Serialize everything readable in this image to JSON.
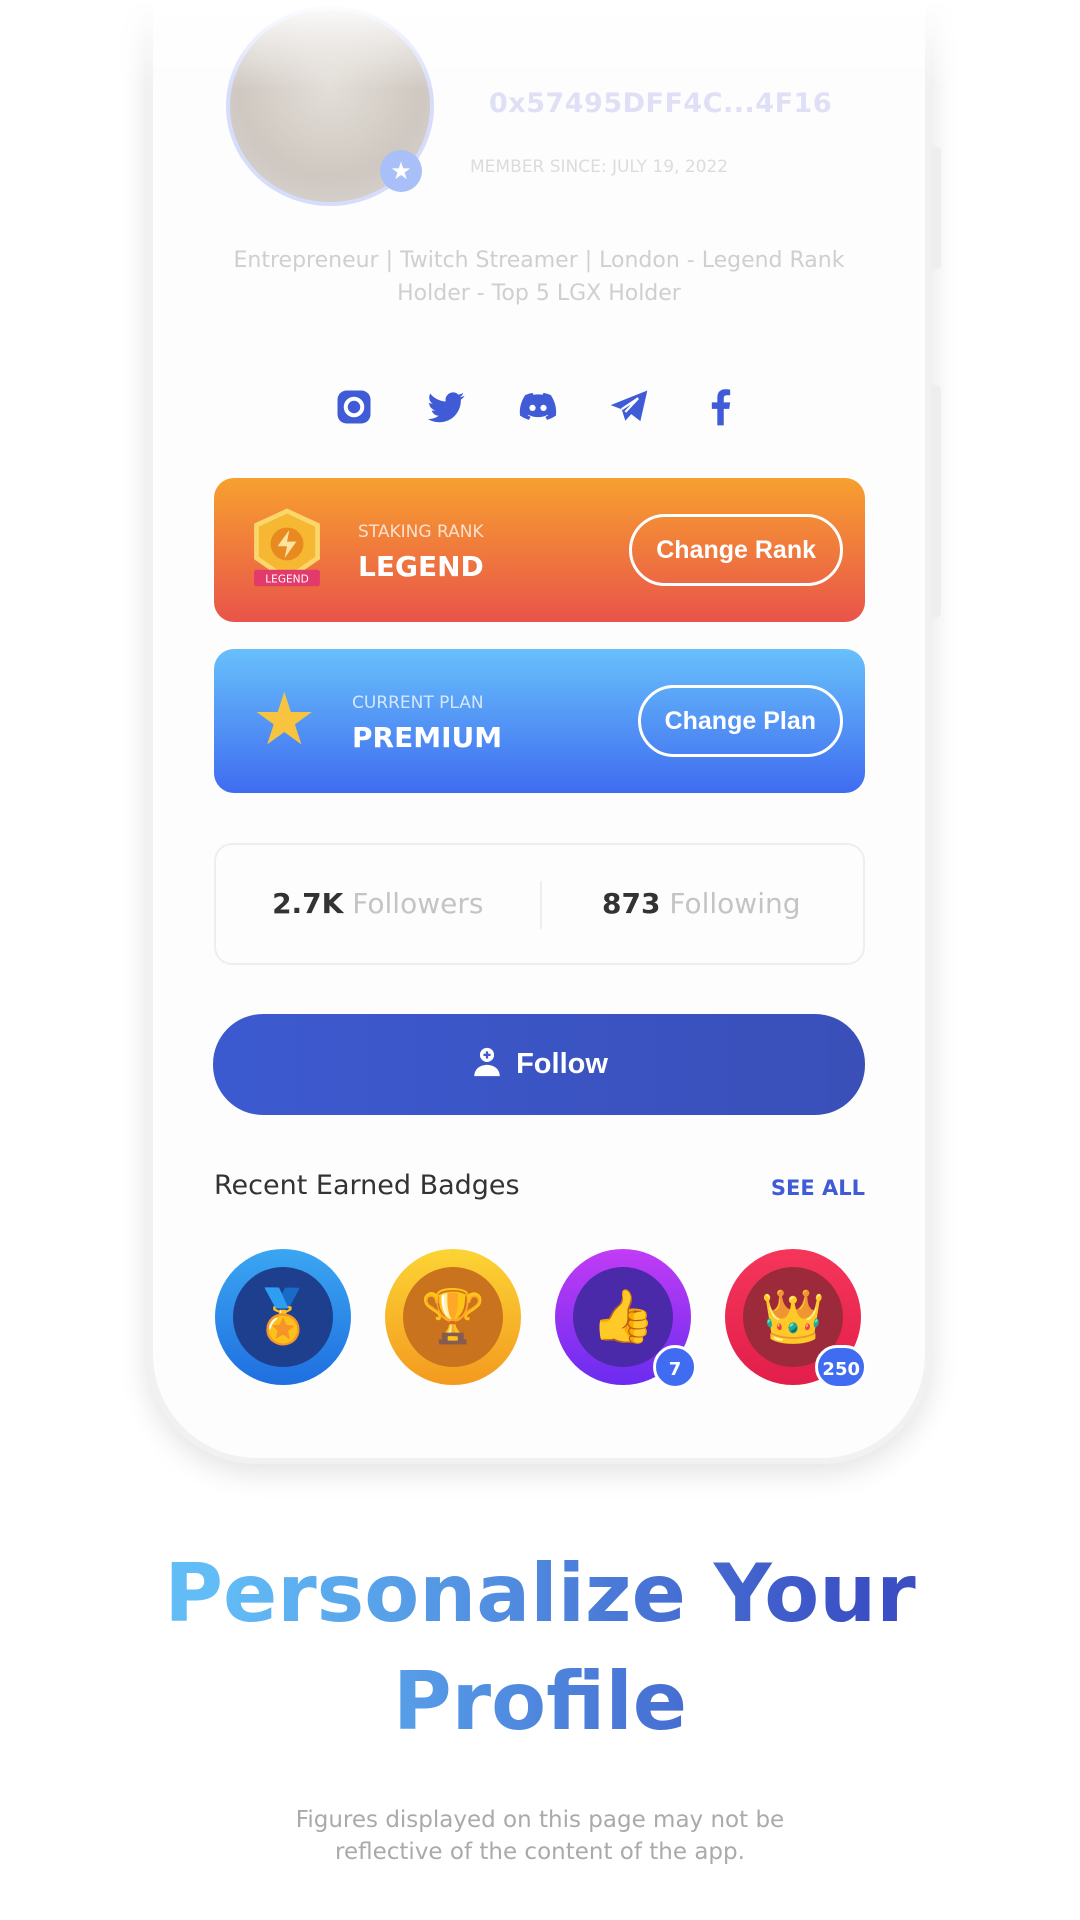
{
  "profile": {
    "address": "0x57495DFF4C...4F16",
    "member_since": "MEMBER SINCE: JULY 19, 2022",
    "bio": "Entrepreneur | Twitch Streamer | London - Legend Rank Holder - Top 5 LGX Holder"
  },
  "socials": [
    "instagram-icon",
    "twitter-icon",
    "discord-icon",
    "telegram-icon",
    "facebook-icon"
  ],
  "rank": {
    "label": "STAKING RANK",
    "value": "LEGEND",
    "button": "Change Rank",
    "emblem_text": "LEGEND"
  },
  "plan": {
    "label": "CURRENT PLAN",
    "value": "PREMIUM",
    "button": "Change Plan"
  },
  "stats": {
    "followers_count": "2.7K",
    "followers_label": "Followers",
    "following_count": "873",
    "following_label": "Following"
  },
  "follow_button": "Follow",
  "badges_section": {
    "title": "Recent Earned Badges",
    "see_all": "SEE ALL",
    "badges": [
      {
        "name": "medal",
        "count": null
      },
      {
        "name": "trophy",
        "count": null
      },
      {
        "name": "thumbs-up",
        "count": "7"
      },
      {
        "name": "crown",
        "count": "250"
      }
    ]
  },
  "headline": {
    "line1": "Personalize Your",
    "line2": "Profile"
  },
  "disclaimer": "Figures displayed on this page may not be reflective of the content of the app.",
  "colors": {
    "accent": "#3f5bd6",
    "rank_gradient": [
      "#f7a02f",
      "#e9544a"
    ],
    "plan_gradient": [
      "#68c0fb",
      "#3f6cf0"
    ]
  }
}
